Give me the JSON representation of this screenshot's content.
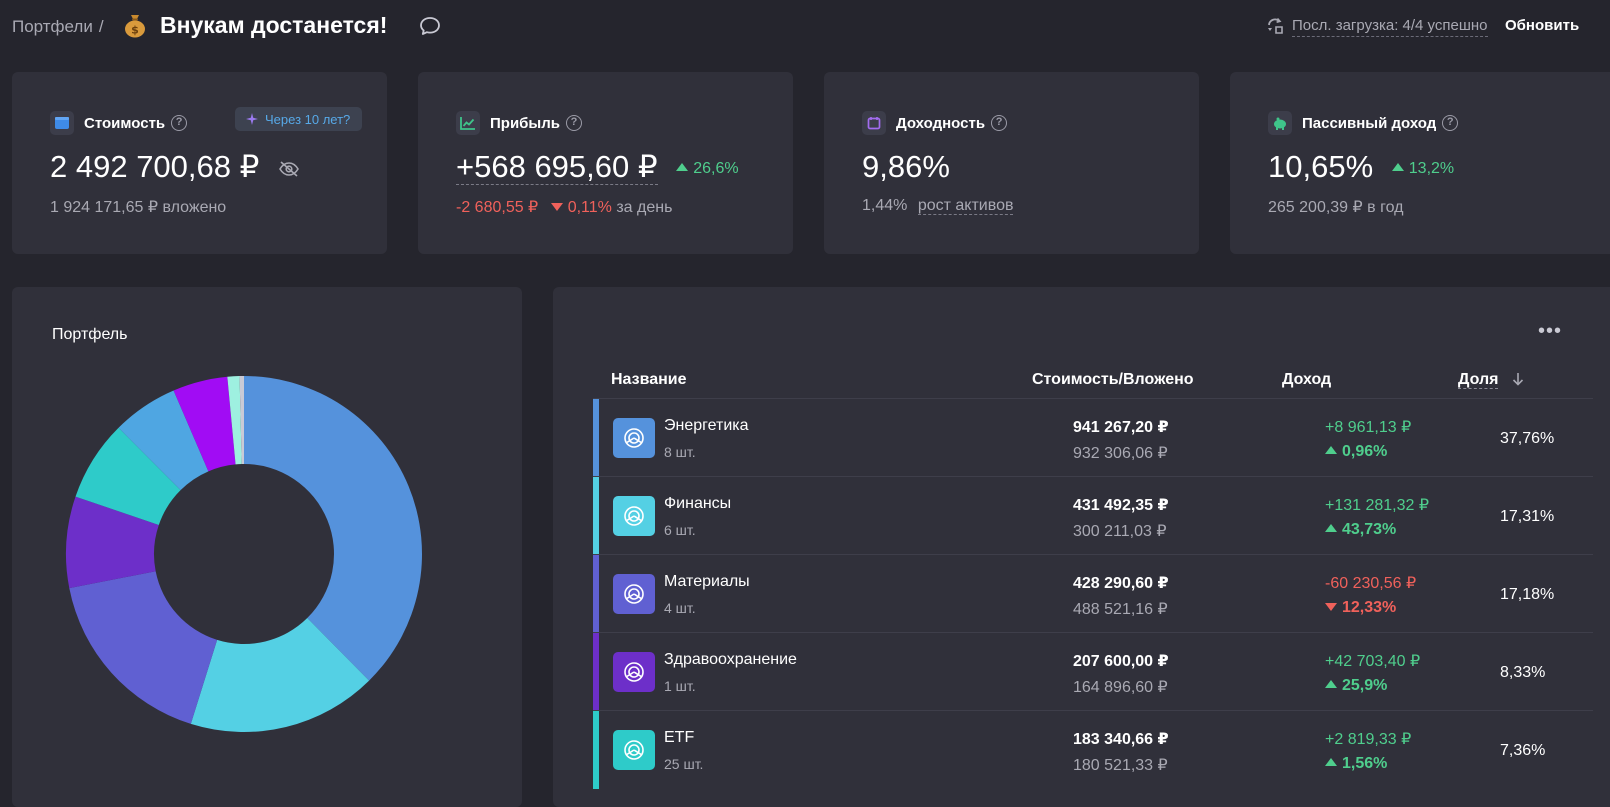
{
  "header": {
    "breadcrumb": "Портфели",
    "breadcrumb_sep": "/",
    "title": "Внукам достанется!",
    "sync_status": "Посл. загрузка: 4/4 успешно",
    "refresh_label": "Обновить"
  },
  "cards": {
    "value": {
      "label": "Стоимость",
      "future_button": "Через 10 лет?",
      "amount": "2 492 700,68 ₽",
      "invested": "1 924 171,65 ₽ вложено"
    },
    "profit": {
      "label": "Прибыль",
      "amount": "+568 695,60 ₽",
      "pct": "26,6%",
      "day_amount": "-2 680,55 ₽",
      "day_pct": "0,11%",
      "day_label": "за день"
    },
    "yield": {
      "label": "Доходность",
      "amount": "9,86%",
      "sub_value": "1,44%",
      "sub_label": "рост активов"
    },
    "passive": {
      "label": "Пассивный доход",
      "amount": "10,65%",
      "pct": "13,2%",
      "sub": "265 200,39 ₽ в год"
    }
  },
  "portfolio_panel": {
    "title": "Портфель"
  },
  "chart_data": {
    "type": "pie",
    "donut": true,
    "series": [
      {
        "label": "Энергетика",
        "share": 37.76,
        "color": "#5592dc"
      },
      {
        "label": "Финансы",
        "share": 17.31,
        "color": "#54d0e4"
      },
      {
        "label": "Материалы",
        "share": 17.18,
        "color": "#6060d2"
      },
      {
        "label": "Здравоохранение",
        "share": 8.33,
        "color": "#6d2fc9"
      },
      {
        "label": "ETF",
        "share": 7.36,
        "color": "#2ecbc9"
      },
      {
        "share": 6.0,
        "color": "#4fa6e2"
      },
      {
        "share": 5.0,
        "color": "#a10cf4"
      },
      {
        "share": 1.1,
        "color": "#9ef0e0"
      },
      {
        "share": 0.4,
        "color": "#c9cad6"
      }
    ]
  },
  "table": {
    "columns": {
      "name": "Название",
      "value": "Стоимость/Вложено",
      "income": "Доход",
      "share": "Доля"
    },
    "rows": [
      {
        "name": "Энергетика",
        "count": "8 шт.",
        "value": "941 267,20 ₽",
        "invested": "932 306,06 ₽",
        "income": "+8 961,13 ₽",
        "income_pct": "0,96%",
        "direction": "up",
        "share": "37,76%",
        "color": "#5592dc"
      },
      {
        "name": "Финансы",
        "count": "6 шт.",
        "value": "431 492,35 ₽",
        "invested": "300 211,03 ₽",
        "income": "+131 281,32 ₽",
        "income_pct": "43,73%",
        "direction": "up",
        "share": "17,31%",
        "color": "#54d0e4"
      },
      {
        "name": "Материалы",
        "count": "4 шт.",
        "value": "428 290,60 ₽",
        "invested": "488 521,16 ₽",
        "income": "-60 230,56 ₽",
        "income_pct": "12,33%",
        "direction": "down",
        "share": "17,18%",
        "color": "#6060d2"
      },
      {
        "name": "Здравоохранение",
        "count": "1 шт.",
        "value": "207 600,00 ₽",
        "invested": "164 896,60 ₽",
        "income": "+42 703,40 ₽",
        "income_pct": "25,9%",
        "direction": "up",
        "share": "8,33%",
        "color": "#6d2fc9"
      },
      {
        "name": "ETF",
        "count": "25 шт.",
        "value": "183 340,66 ₽",
        "invested": "180 521,33 ₽",
        "income": "+2 819,33 ₽",
        "income_pct": "1,56%",
        "direction": "up",
        "share": "7,36%",
        "color": "#2ecbc9"
      }
    ]
  }
}
